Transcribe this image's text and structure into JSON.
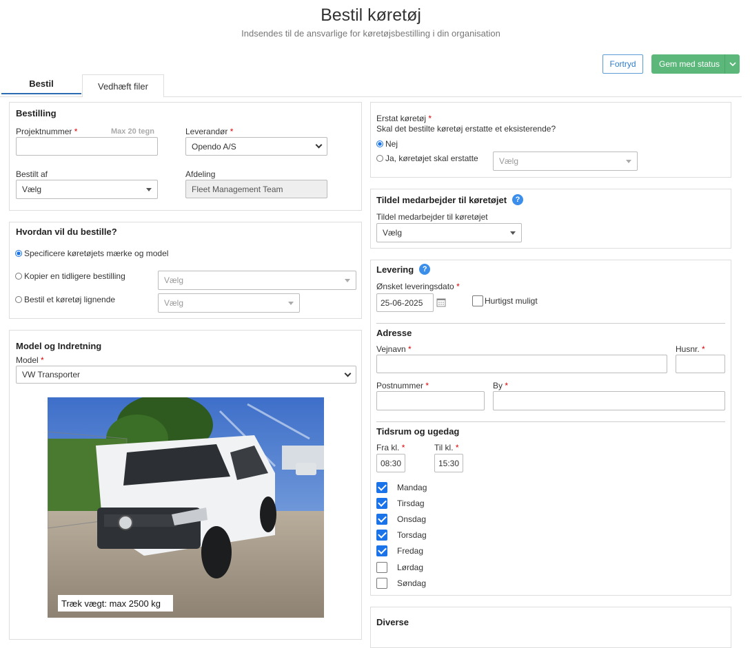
{
  "header": {
    "title": "Bestil køretøj",
    "subtitle": "Indsendes til de ansvarlige for køretøjsbestilling i din organisation"
  },
  "actions": {
    "cancel_label": "Fortryd",
    "save_label": "Gem med status"
  },
  "tabs": [
    {
      "label": "Bestil",
      "active": true
    },
    {
      "label": "Vedhæft filer",
      "active": false
    }
  ],
  "bestilling": {
    "heading": "Bestilling",
    "project_label": "Projektnummer",
    "project_hint": "Max 20 tegn",
    "project_value": "",
    "supplier_label": "Leverandør",
    "supplier_value": "Opendo A/S",
    "ordered_by_label": "Bestilt af",
    "ordered_by_value": "Vælg",
    "department_label": "Afdeling",
    "department_value": "Fleet Management Team"
  },
  "how": {
    "heading": "Hvordan vil du bestille?",
    "opt_specify": "Specificere køretøjets mærke og model",
    "opt_copy": "Kopier en tidligere bestilling",
    "copy_select": "Vælg",
    "opt_similar": "Bestil et køretøj lignende",
    "similar_select": "Vælg"
  },
  "model": {
    "heading": "Model og Indretning",
    "model_label": "Model",
    "model_value": "VW Transporter",
    "image_caption": "Træk vægt: max 2500 kg"
  },
  "replace": {
    "label": "Erstat køretøj",
    "question": "Skal det bestilte køretøj erstatte et eksisterende?",
    "opt_no": "Nej",
    "opt_yes": "Ja, køretøjet skal erstatte",
    "select_value": "Vælg"
  },
  "assign": {
    "heading": "Tildel medarbejder til køretøjet",
    "label": "Tildel medarbejder til køretøjet",
    "select_value": "Vælg"
  },
  "delivery": {
    "heading": "Levering",
    "date_label": "Ønsket leveringsdato",
    "date_value": "25-06-2025",
    "asap_label": "Hurtigst muligt",
    "address_heading": "Adresse",
    "street_label": "Vejnavn",
    "house_label": "Husnr.",
    "zip_label": "Postnummer",
    "city_label": "By",
    "time_heading": "Tidsrum og ugedag",
    "from_label": "Fra kl.",
    "from_value": "08:30",
    "to_label": "Til kl.",
    "to_value": "15:30",
    "days": [
      {
        "label": "Mandag",
        "checked": true
      },
      {
        "label": "Tirsdag",
        "checked": true
      },
      {
        "label": "Onsdag",
        "checked": true
      },
      {
        "label": "Torsdag",
        "checked": true
      },
      {
        "label": "Fredag",
        "checked": true
      },
      {
        "label": "Lørdag",
        "checked": false
      },
      {
        "label": "Søndag",
        "checked": false
      }
    ]
  },
  "misc": {
    "heading": "Diverse"
  },
  "colors": {
    "primary": "#1a73e8",
    "save": "#5cb87a",
    "required": "#dd0000"
  },
  "icons": [
    "help-icon",
    "calendar-icon",
    "chevron-down-icon"
  ]
}
